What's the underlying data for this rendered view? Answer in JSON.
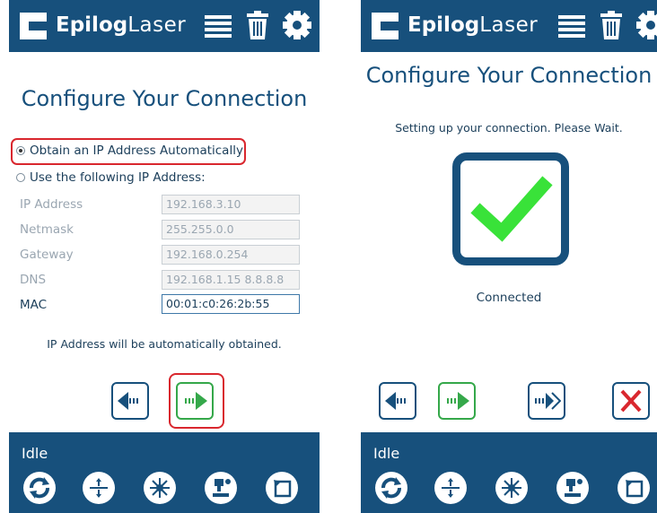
{
  "brand": {
    "bold": "Epilog",
    "light": "Laser"
  },
  "colors": {
    "primary": "#17507c",
    "accent_green": "#35a84a",
    "check_green": "#39e239",
    "highlight_red": "#d9272e"
  },
  "top_icons": [
    "list-icon",
    "trash-icon",
    "gear-icon"
  ],
  "left_screen": {
    "title": "Configure Your Connection",
    "radio_auto": {
      "label": "Obtain an IP Address Automatically",
      "selected": true
    },
    "radio_manual": {
      "label": "Use the following IP Address:",
      "selected": false
    },
    "fields": [
      {
        "label": "IP Address",
        "value": "192.168.3.10",
        "enabled": false
      },
      {
        "label": "Netmask",
        "value": "255.255.0.0",
        "enabled": false
      },
      {
        "label": "Gateway",
        "value": "192.168.0.254",
        "enabled": false
      },
      {
        "label": "DNS",
        "value": "192.168.1.15 8.8.8.8",
        "enabled": false
      },
      {
        "label": "MAC",
        "value": "00:01:c0:26:2b:55",
        "enabled": true
      }
    ],
    "note": "IP Address will be automatically obtained.",
    "nav_buttons": [
      "back-arrow-icon",
      "next-arrow-icon"
    ]
  },
  "right_screen": {
    "title": "Configure Your Connection",
    "subtitle": "Setting up your connection. Please Wait.",
    "status_text": "Connected",
    "nav_buttons": [
      "back-arrow-icon",
      "next-arrow-icon",
      "skip-arrow-icon",
      "close-x-icon"
    ]
  },
  "status_bar": {
    "status": "Idle",
    "icons": [
      "refresh-icon",
      "jog-icon",
      "laser-icon",
      "focus-icon",
      "home-icon"
    ]
  }
}
